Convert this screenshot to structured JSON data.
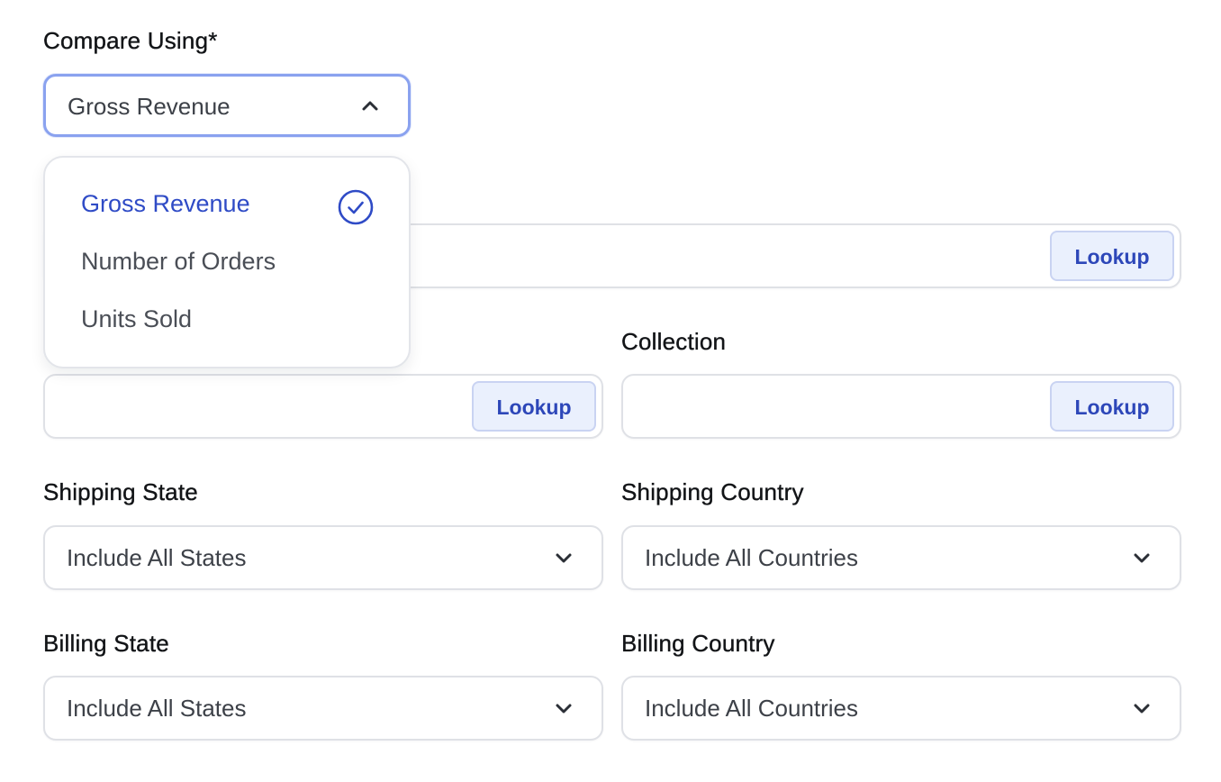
{
  "compare": {
    "label": "Compare Using*",
    "value": "Gross Revenue",
    "options": [
      "Gross Revenue",
      "Number of Orders",
      "Units Sold"
    ],
    "selected_index": 0
  },
  "row1": {
    "lookup_label": "Lookup"
  },
  "row2": {
    "left_lookup_label": "Lookup",
    "collection_label": "Collection",
    "collection_lookup_label": "Lookup"
  },
  "shipping": {
    "state_label": "Shipping State",
    "state_value": "Include All States",
    "country_label": "Shipping Country",
    "country_value": "Include All Countries"
  },
  "billing": {
    "state_label": "Billing State",
    "state_value": "Include All States",
    "country_label": "Billing Country",
    "country_value": "Include All Countries"
  },
  "colors": {
    "accent": "#2f4bc6",
    "focus_border": "#8aa2ef",
    "lookup_bg": "#eaf0fd"
  }
}
